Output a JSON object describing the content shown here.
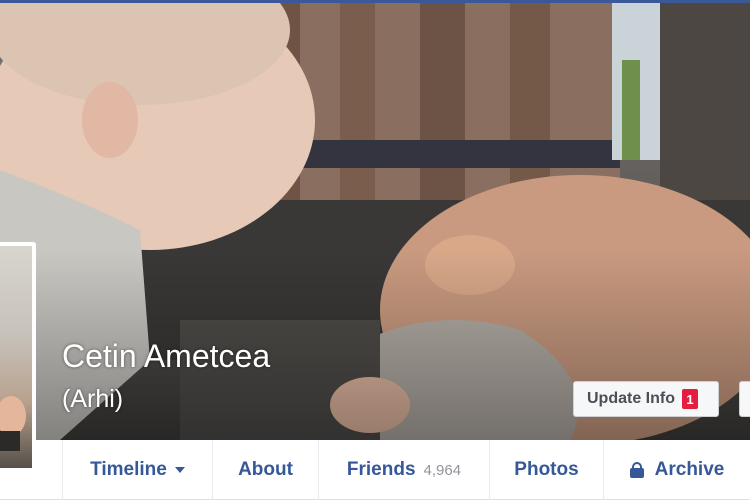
{
  "profile": {
    "name": "Cetin Ametcea",
    "nickname": "(Arhi)"
  },
  "actions": {
    "update_info_label": "Update Info",
    "update_info_badge": "1"
  },
  "nav": {
    "tabs": [
      {
        "label": "Timeline",
        "icon": "chevron-down-icon"
      },
      {
        "label": "About"
      },
      {
        "label": "Friends",
        "count": "4,964"
      },
      {
        "label": "Photos"
      },
      {
        "label": "Archive",
        "icon": "lock-icon"
      }
    ]
  },
  "colors": {
    "link": "#365899",
    "badge": "#e41e3f",
    "top_bar": "#3b5998"
  }
}
